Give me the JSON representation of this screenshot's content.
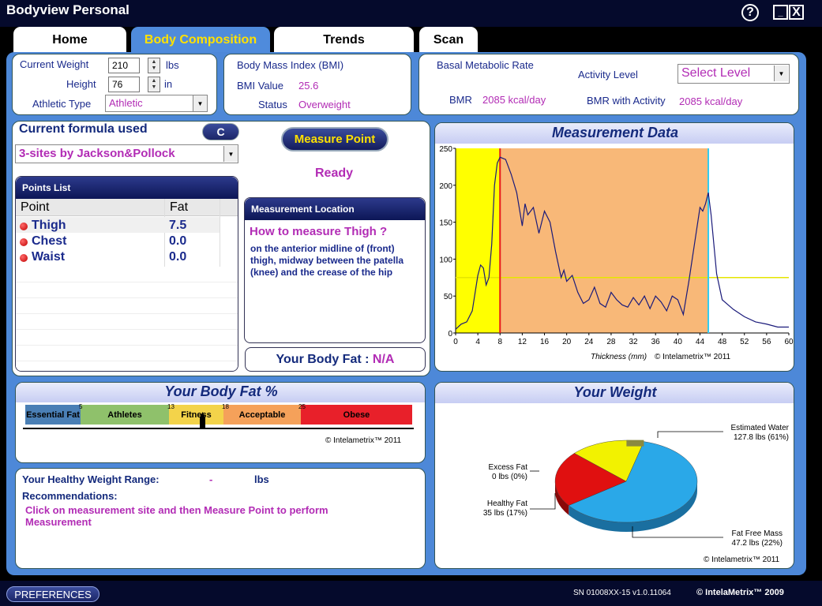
{
  "app": {
    "title": "Bodyview Personal",
    "help_glyph": "?",
    "min_glyph": "_",
    "close_glyph": "X"
  },
  "tabs": [
    {
      "label": "Home"
    },
    {
      "label": "Body Composition"
    },
    {
      "label": "Trends"
    },
    {
      "label": "Scan"
    }
  ],
  "profile": {
    "weight_label": "Current Weight",
    "weight": "210",
    "weight_unit": "lbs",
    "height_label": "Height",
    "height": "76",
    "height_unit": "in",
    "athletic_label": "Athletic Type",
    "athletic": "Athletic"
  },
  "bmi": {
    "title": "Body Mass Index (BMI)",
    "value_label": "BMI Value",
    "value": "25.6",
    "status_label": "Status",
    "status": "Overweight"
  },
  "bmr": {
    "title": "Basal Metabolic Rate",
    "activity_label": "Activity Level",
    "activity": "Select Level",
    "bmr_label": "BMR",
    "bmr": "2085 kcal/day",
    "bmr_act_label": "BMR with Activity",
    "bmr_act": "2085 kcal/day"
  },
  "formula": {
    "label": "Current formula used",
    "c_button": "C",
    "selected": "3-sites by Jackson&Pollock"
  },
  "measure": {
    "button": "Measure Point",
    "status": "Ready"
  },
  "points": {
    "title": "Points List",
    "col_point": "Point",
    "col_fat": "Fat",
    "rows": [
      {
        "name": "Thigh",
        "fat": "7.5"
      },
      {
        "name": "Chest",
        "fat": "0.0"
      },
      {
        "name": "Waist",
        "fat": "0.0"
      }
    ]
  },
  "location": {
    "title": "Measurement Location",
    "heading": "How to measure Thigh ?",
    "text": "on the anterior midline of (front) thigh, midway between the patella (knee) and the crease of the hip"
  },
  "bodyfat": {
    "label": "Your Body Fat :",
    "value": "N/A",
    "section_title": "Your Body Fat %",
    "copyright": "© Intelametrix™ 2011",
    "segments": [
      {
        "label": "Essential Fat",
        "color": "#4a7fb5"
      },
      {
        "label": "Athletes",
        "color": "#8fc16b"
      },
      {
        "label": "Fitness",
        "color": "#f3d34a"
      },
      {
        "label": "Acceptable",
        "color": "#f5a15a"
      },
      {
        "label": "Obese",
        "color": "#e8202a"
      }
    ],
    "thresholds": [
      "5",
      "13",
      "18",
      "25"
    ]
  },
  "weight_range": {
    "label": "Your Healthy Weight Range:",
    "value": "-",
    "unit": "lbs",
    "rec_label": "Recommendations:",
    "rec_text": "Click on measurement site and then Measure Point to perform Measurement"
  },
  "measurement_chart": {
    "title": "Measurement Data",
    "copyright": "© Intelametrix™ 2011"
  },
  "chart_data": [
    {
      "type": "line",
      "title": "Measurement Data",
      "xlabel": "Thickness (mm)",
      "ylabel": "",
      "xlim": [
        0,
        60
      ],
      "ylim": [
        0,
        250
      ],
      "x_ticks": [
        "0",
        "4",
        "8",
        "12",
        "16",
        "20",
        "24",
        "28",
        "32",
        "36",
        "40",
        "44",
        "48",
        "52",
        "56",
        "60"
      ],
      "y_ticks": [
        "0",
        "50",
        "100",
        "150",
        "200",
        "250"
      ],
      "x": [
        0,
        1,
        2,
        3,
        4,
        4.5,
        5,
        5.5,
        6,
        6.5,
        7,
        7.5,
        8,
        9,
        10,
        11,
        12,
        12.5,
        13,
        14,
        15,
        16,
        17,
        18,
        19,
        19.5,
        20,
        21,
        22,
        23,
        24,
        25,
        26,
        27,
        28,
        29,
        30,
        31,
        32,
        33,
        34,
        35,
        36,
        37,
        38,
        38.5,
        39,
        40,
        41,
        42,
        43,
        44,
        44.5,
        45,
        45.5,
        46,
        47,
        48,
        50,
        52,
        54,
        56,
        58,
        60
      ],
      "y": [
        5,
        12,
        15,
        30,
        78,
        92,
        88,
        65,
        75,
        120,
        200,
        230,
        238,
        235,
        215,
        190,
        145,
        175,
        160,
        170,
        135,
        165,
        150,
        110,
        75,
        85,
        70,
        78,
        55,
        40,
        45,
        62,
        40,
        35,
        55,
        45,
        38,
        35,
        48,
        38,
        50,
        33,
        50,
        42,
        30,
        40,
        50,
        45,
        25,
        70,
        120,
        170,
        165,
        175,
        190,
        160,
        80,
        45,
        32,
        22,
        15,
        12,
        8,
        8
      ],
      "regions": [
        {
          "from": 0,
          "to": 8,
          "color": "#ffff00"
        },
        {
          "from": 8,
          "to": 45.5,
          "color": "#f8b878"
        }
      ],
      "markers": [
        {
          "x": 8,
          "color": "#e81a1a"
        },
        {
          "x": 45.5,
          "color": "#33ccee"
        }
      ],
      "threshold_y": 75
    },
    {
      "type": "pie",
      "title": "Your Weight",
      "copyright": "© Intelametrix™ 2011",
      "slices": [
        {
          "label": "Estimated Water",
          "value_text": "127.8 lbs (61%)",
          "value": 61,
          "color": "#2aa8e8"
        },
        {
          "label": "Fat Free Mass",
          "value_text": "47.2 lbs (22%)",
          "value": 22,
          "color": "#e01010"
        },
        {
          "label": "Healthy Fat",
          "value_text": "35 lbs (17%)",
          "value": 17,
          "color": "#f2f200"
        },
        {
          "label": "Excess Fat",
          "value_text": "0 lbs (0%)",
          "value": 0,
          "color": "#8a8a40"
        }
      ]
    }
  ],
  "footer": {
    "preferences": "PREFERENCES",
    "serial": "SN 01008XX-15 v1.0.11064",
    "brand": "© IntelaMetrix™  2009"
  }
}
